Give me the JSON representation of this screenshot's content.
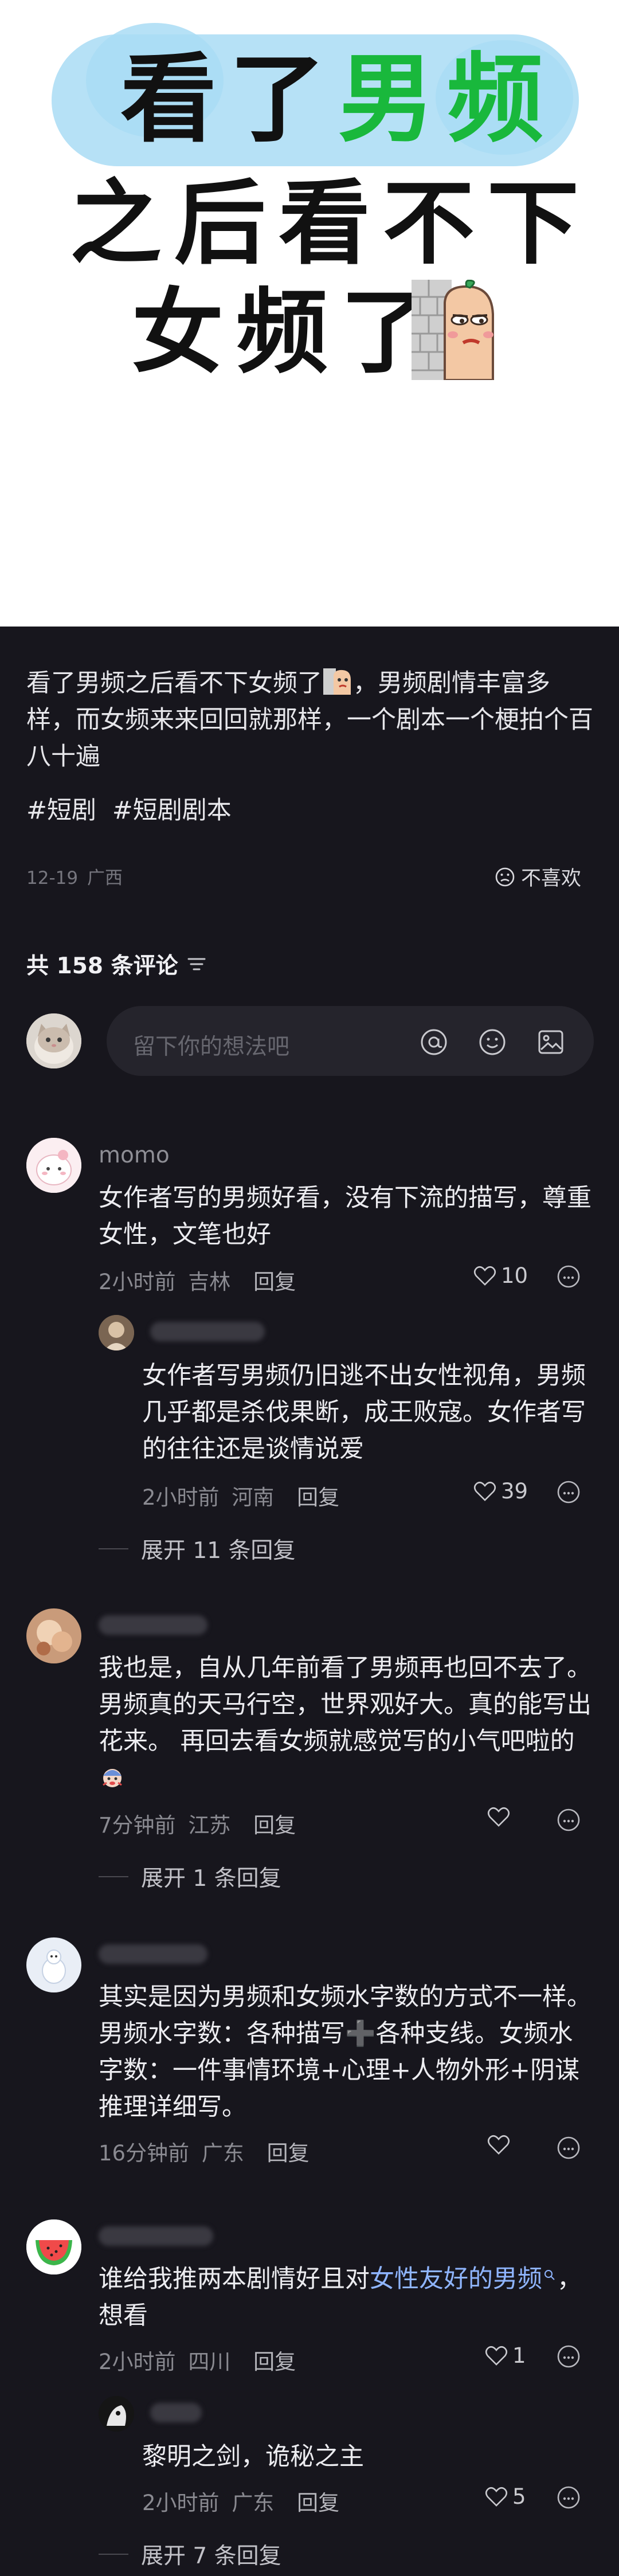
{
  "cover": {
    "line1_black": "看了",
    "line1_green": "男频",
    "line2": "之后看不下",
    "line3": "女频了"
  },
  "post": {
    "text_before_emoji": "看了男频之后看不下女频了",
    "text_after_emoji": "，男频剧情丰富多样，而女频来来回回就那样，一个剧本一个梗拍个百八十遍",
    "tags": [
      "#短剧",
      "#短剧剧本"
    ],
    "date": "12-19",
    "location": "广西",
    "dislike_label": "不喜欢"
  },
  "comments_header": {
    "count_label": "共 158 条评论",
    "input_placeholder": "留下你的想法吧"
  },
  "comments": [
    {
      "user": "momo",
      "text": "女作者写的男频好看，没有下流的描写，尊重女性，文笔也好",
      "time": "2小时前",
      "location": "吉林",
      "reply_label": "回复",
      "likes": "10",
      "replies": [
        {
          "text": "女作者写男频仍旧逃不出女性视角，男频几乎都是杀伐果断，成王败寇。女作者写的往往还是谈情说爱",
          "time": "2小时前",
          "location": "河南",
          "reply_label": "回复",
          "likes": "39"
        }
      ],
      "expand_label": "展开 11 条回复"
    },
    {
      "user": "",
      "text": "我也是，自从几年前看了男频再也回不去了。男频真的天马行空，世界观好大。真的能写出花来。    再回去看女频就感觉写的小气吧啦的",
      "time": "7分钟前",
      "location": "江苏",
      "reply_label": "回复",
      "likes": "",
      "expand_label": "展开 1 条回复"
    },
    {
      "user": "",
      "text": "其实是因为男频和女频水字数的方式不一样。男频水字数：各种描写➕各种支线。女频水字数：一件事情环境+心理+人物外形+阴谋推理详细写。",
      "time": "16分钟前",
      "location": "广东",
      "reply_label": "回复",
      "likes": ""
    },
    {
      "user": "",
      "text_before_link": "谁给我推两本剧情好且对",
      "link_text": "女性友好的男频",
      "text_after_link": "，想看",
      "time": "2小时前",
      "location": "四川",
      "reply_label": "回复",
      "likes": "1",
      "replies": [
        {
          "text": "黎明之剑，诡秘之主",
          "time": "2小时前",
          "location": "广东",
          "reply_label": "回复",
          "likes": "5"
        }
      ],
      "expand_label": "展开 7 条回复"
    }
  ],
  "colors": {
    "background": "#17161d",
    "cover_green": "#19b83c",
    "link_blue": "#8fb5ff"
  },
  "icons": [
    "funnel-icon",
    "at-icon",
    "emoji-icon",
    "image-icon",
    "heart-icon",
    "more-icon",
    "frown-icon"
  ]
}
